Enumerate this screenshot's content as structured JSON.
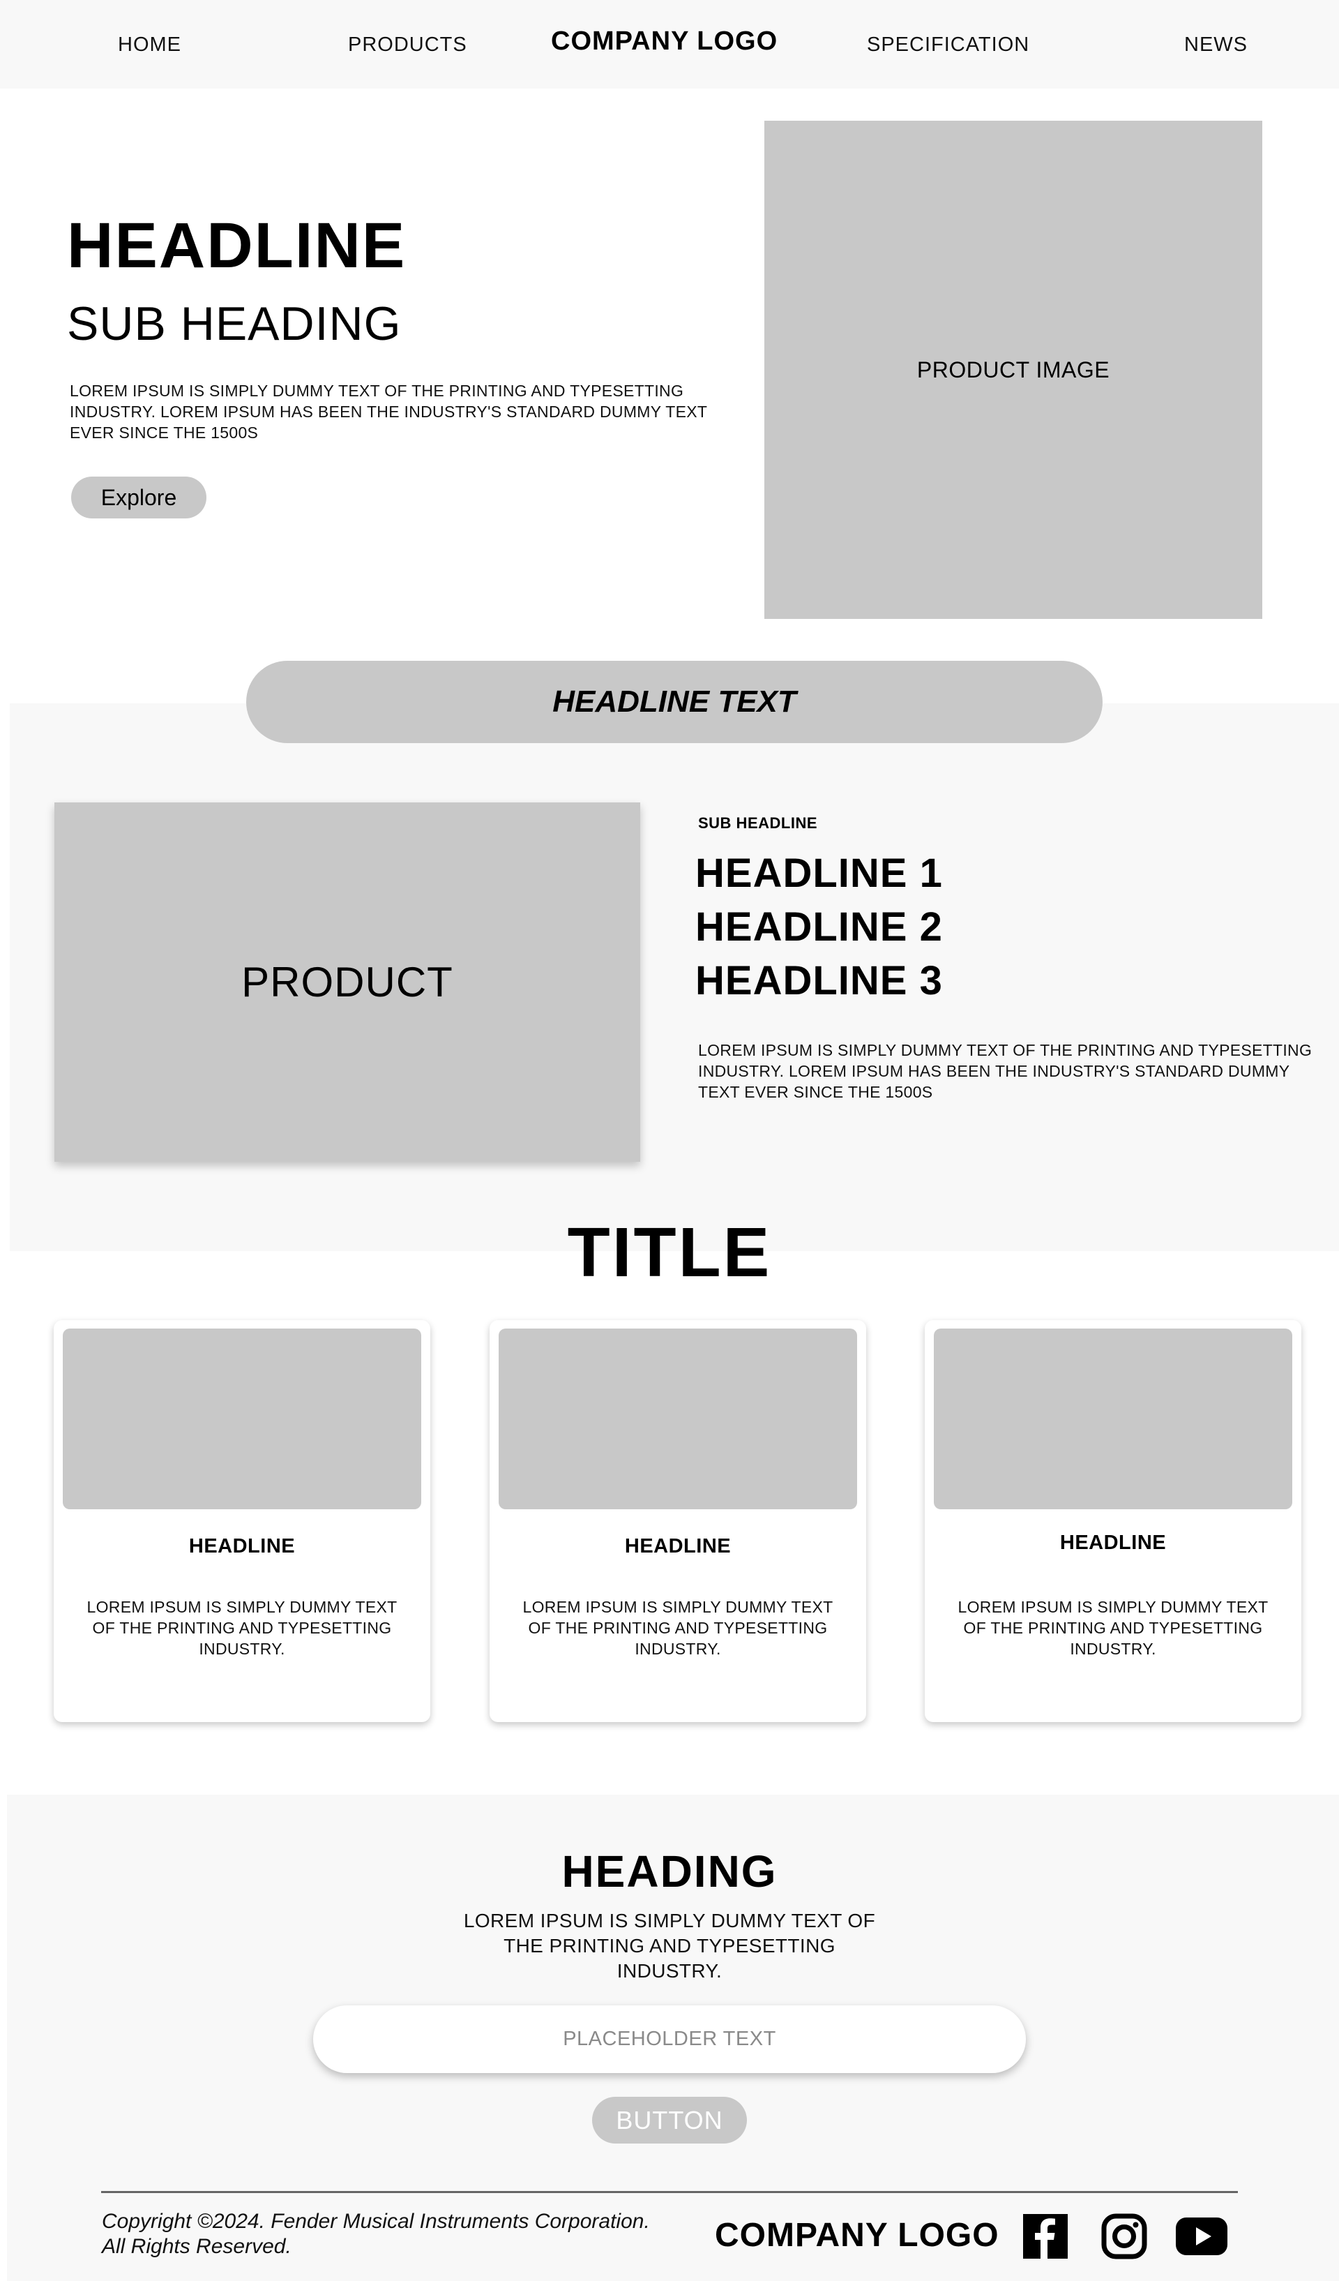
{
  "nav": {
    "home": "HOME",
    "products": "PRODUCTS",
    "logo": "COMPANY LOGO",
    "specification": "SPECIFICATION",
    "news": "NEWS"
  },
  "hero": {
    "headline": "HEADLINE",
    "sub_heading": "SUB HEADING",
    "body": "LOREM IPSUM IS SIMPLY DUMMY TEXT OF THE PRINTING AND TYPESETTING INDUSTRY. LOREM IPSUM HAS BEEN THE INDUSTRY'S STANDARD DUMMY TEXT EVER SINCE THE 1500S",
    "explore_label": "Explore",
    "image_label": "PRODUCT IMAGE"
  },
  "feature": {
    "pill_text": "HEADLINE TEXT",
    "product_label": "PRODUCT",
    "sub_headline": "SUB HEADLINE",
    "headline_1": "HEADLINE 1",
    "headline_2": "HEADLINE 2",
    "headline_3": "HEADLINE 3",
    "body": "LOREM IPSUM IS SIMPLY DUMMY TEXT OF THE PRINTING AND TYPESETTING INDUSTRY. LOREM IPSUM HAS BEEN THE INDUSTRY'S STANDARD DUMMY TEXT EVER SINCE THE 1500S"
  },
  "cards": {
    "title": "TITLE",
    "items": [
      {
        "headline": "HEADLINE",
        "body": "LOREM IPSUM IS SIMPLY DUMMY TEXT OF THE PRINTING AND TYPESETTING INDUSTRY."
      },
      {
        "headline": "HEADLINE",
        "body": "LOREM IPSUM IS SIMPLY DUMMY TEXT OF THE PRINTING AND TYPESETTING INDUSTRY."
      },
      {
        "headline": "HEADLINE",
        "body": "LOREM IPSUM IS SIMPLY DUMMY TEXT OF THE PRINTING AND TYPESETTING INDUSTRY."
      }
    ]
  },
  "newsletter": {
    "heading": "HEADING",
    "body": "LOREM IPSUM IS SIMPLY DUMMY TEXT OF THE PRINTING AND TYPESETTING INDUSTRY.",
    "input_placeholder": "PLACEHOLDER TEXT",
    "button_label": "BUTTON"
  },
  "footer": {
    "copyright_line1": "Copyright ©2024. Fender Musical Instruments Corporation.",
    "copyright_line2": "All Rights Reserved.",
    "logo": "COMPANY LOGO",
    "icons": [
      "facebook-icon",
      "instagram-icon",
      "youtube-icon"
    ]
  },
  "colors": {
    "placeholder_gray": "#c8c8c8",
    "section_bg": "#f8f8f8",
    "text": "#000000"
  }
}
